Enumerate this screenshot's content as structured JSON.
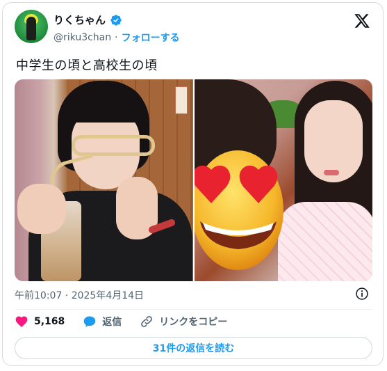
{
  "user": {
    "display_name": "りくちゃん",
    "handle": "@riku3chan",
    "separator": "·",
    "follow_label": "フォローする"
  },
  "tweet": {
    "text": "中学生の頃と高校生の頃"
  },
  "meta": {
    "timestamp": "午前10:07 · 2025年4月14日"
  },
  "actions": {
    "likes_count": "5,168",
    "reply_label": "返信",
    "copy_link_label": "リンクをコピー"
  },
  "replies_button": {
    "label": "31件の返信を読む"
  },
  "colors": {
    "accent": "#1d9bf0",
    "like": "#f91880",
    "text": "#0f1419",
    "muted": "#536471"
  },
  "icons": [
    "verified-badge-icon",
    "x-logo-icon",
    "info-icon",
    "heart-icon",
    "reply-bubble-icon",
    "link-icon"
  ]
}
